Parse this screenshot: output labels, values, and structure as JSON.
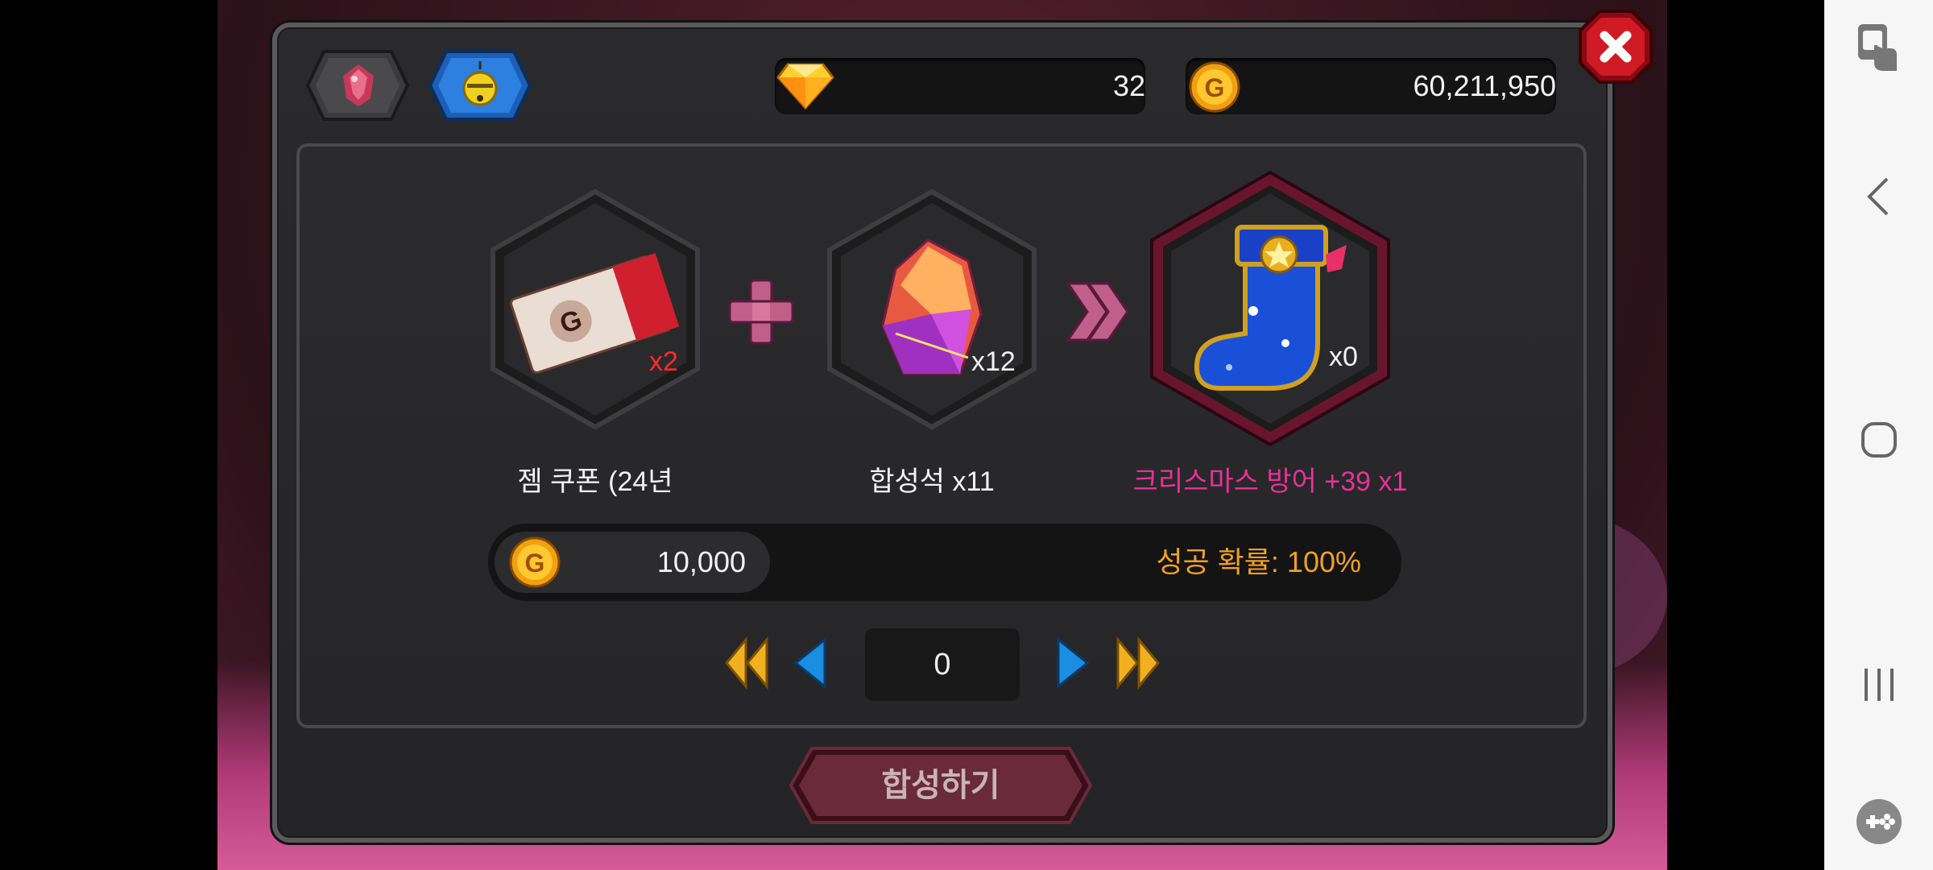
{
  "currency": {
    "gems": "32",
    "gold": "60,211,950"
  },
  "tabs": [
    {
      "name": "gem-tab",
      "active": false
    },
    {
      "name": "bell-tab",
      "active": true
    }
  ],
  "recipe": {
    "ingredient1": {
      "label": "젬 쿠폰 (24년",
      "qty": "x2"
    },
    "ingredient2": {
      "label": "합성석 x11",
      "qty": "x12"
    },
    "result": {
      "label": "크리스마스 방어 +39 x1",
      "qty": "x0"
    }
  },
  "cost": "10,000",
  "success_rate": "성공 확률: 100%",
  "counter_value": "0",
  "synthesize_label": "합성하기",
  "colors": {
    "gold_text": "#f0a020",
    "pink_text": "#e8309a",
    "qty_red": "#ff2a2a"
  }
}
